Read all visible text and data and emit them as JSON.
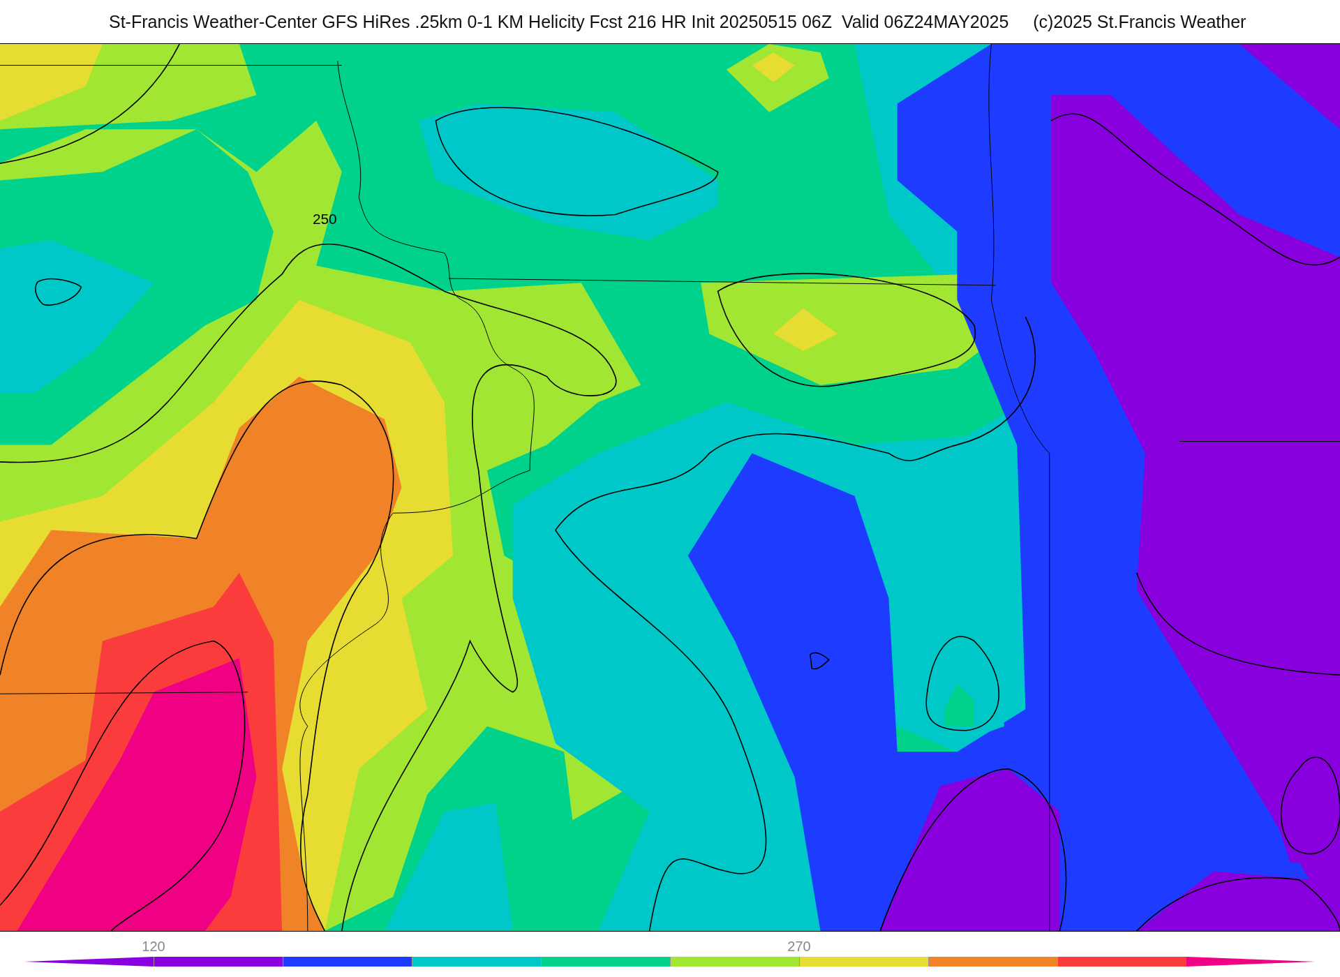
{
  "title": "St-Francis Weather-Center GFS HiRes .25km 0-1 KM Helicity Fcst 216 HR Init 20250515 06Z  Valid 06Z24MAY2025     (c)2025 St.Francis Weather",
  "map": {
    "contour_labels": [
      "250"
    ]
  },
  "color_scale": [
    {
      "kind": "arrow-left",
      "color": "#8800dd"
    },
    {
      "kind": "band",
      "color": "#8800dd",
      "label": "120"
    },
    {
      "kind": "band",
      "color": "#1e3cff"
    },
    {
      "kind": "band",
      "color": "#00c8c8"
    },
    {
      "kind": "band",
      "color": "#00d28c"
    },
    {
      "kind": "band",
      "color": "#a0e632"
    },
    {
      "kind": "band",
      "color": "#e6dc32",
      "label": "270"
    },
    {
      "kind": "band",
      "color": "#f08228"
    },
    {
      "kind": "band",
      "color": "#fa3c3c"
    },
    {
      "kind": "arrow-right",
      "color": "#f00082"
    }
  ]
}
